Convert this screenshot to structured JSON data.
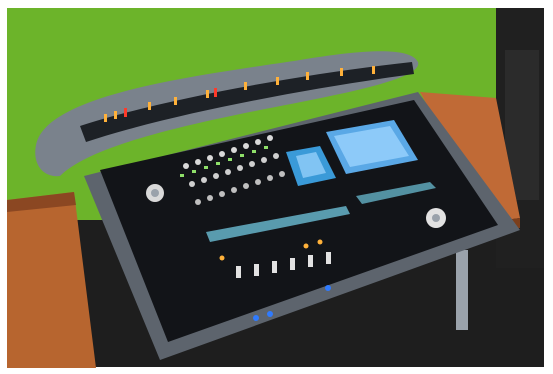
{
  "scene": {
    "subject": "mixing-console",
    "colors": {
      "wall": "#6cb42a",
      "wall_dark": "#4e8f1c",
      "desk_wood": "#c06a36",
      "desk_wood_dark": "#8a4520",
      "floor": "#1f1f1f",
      "console_frame": "#5f6670",
      "console_frame_light": "#9aa2ab",
      "panel_dark": "#121418",
      "screen_blue": "#3a9ad8",
      "screen_light": "#9fd6ff",
      "led_amber": "#ffb13a",
      "led_red": "#ff3a2a",
      "led_green": "#8fe06a",
      "led_blue": "#2f7bff",
      "chrome": "#d9d9d9"
    }
  }
}
